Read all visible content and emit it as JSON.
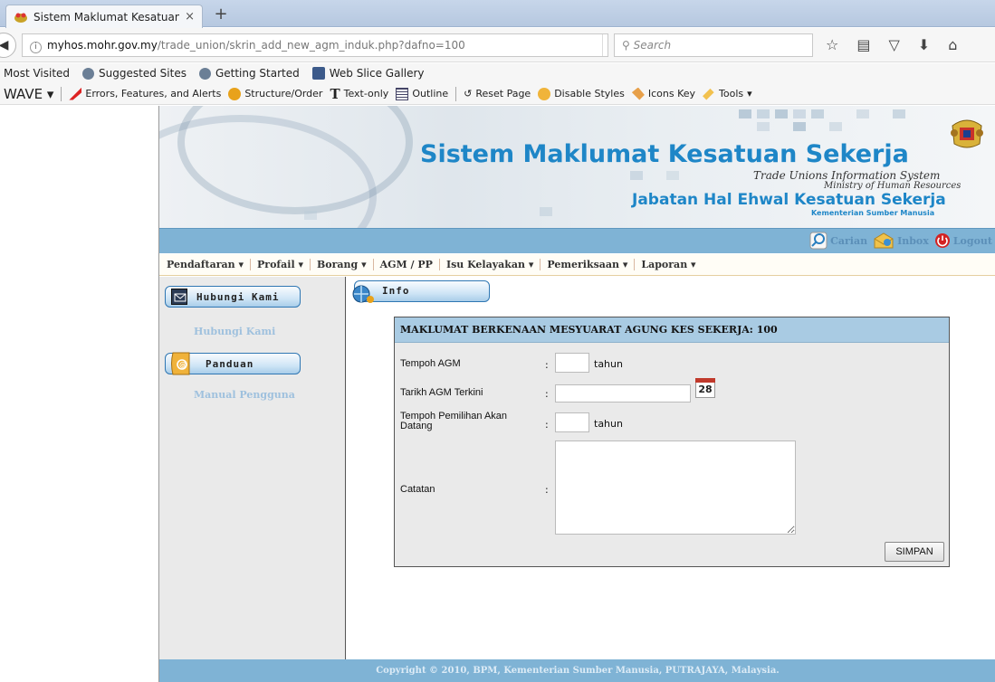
{
  "browser": {
    "tab_title": "Sistem Maklumat Kesatuan...",
    "tab_close": "×",
    "new_tab": "+",
    "url_domain": "myhos.mohr.gov.my",
    "url_path": "/trade_union/skrin_add_new_agm_induk.php?dafno=100",
    "search_placeholder": "Search",
    "bookmarks": [
      "Most Visited",
      "Suggested Sites",
      "Getting Started",
      "Web Slice Gallery"
    ],
    "wave_label": "WAVE",
    "wave_items": [
      "Errors, Features, and Alerts",
      "Structure/Order",
      "Text-only",
      "Outline",
      "Reset Page",
      "Disable Styles",
      "Icons Key",
      "Tools"
    ]
  },
  "banner": {
    "title": "Sistem Maklumat Kesatuan Sekerja",
    "subtitle1": "Trade Unions Information System",
    "subtitle2": "Ministry of Human Resources",
    "dept": "Jabatan Hal Ehwal Kesatuan Sekerja",
    "dept_sub": "Kementerian Sumber Manusia"
  },
  "toplinks": [
    "Carian",
    "Inbox",
    "Logout"
  ],
  "menu": [
    "Pendaftaran",
    "Profail",
    "Borang",
    "AGM / PP",
    "Isu Kelayakan",
    "Pemeriksaan",
    "Laporan"
  ],
  "menu_dropdown": [
    true,
    true,
    true,
    false,
    true,
    true,
    true
  ],
  "sidebar": {
    "hubungi_button": "Hubungi Kami",
    "hubungi_link": "Hubungi Kami",
    "panduan_button": "Panduan",
    "manual_link": "Manual Pengguna"
  },
  "main": {
    "info_tab": "Info",
    "form_heading": "MAKLUMAT BERKENAAN MESYUARAT AGUNG KES SEKERJA: 100",
    "fields": {
      "tempoh_agm_label": "Tempoh AGM",
      "tempoh_agm_unit": "tahun",
      "tempoh_agm_value": "",
      "tarikh_label": "Tarikh AGM Terkini",
      "tarikh_value": "",
      "calendar_day": "28",
      "pemilihan_label": "Tempoh Pemilihan Akan Datang",
      "pemilihan_unit": "tahun",
      "pemilihan_value": "",
      "catatan_label": "Catatan",
      "catatan_value": "",
      "colon": ":"
    },
    "save_button": "SIMPAN"
  },
  "footer": "Copyright © 2010, BPM, Kementerian Sumber Manusia, PUTRAJAYA, Malaysia."
}
